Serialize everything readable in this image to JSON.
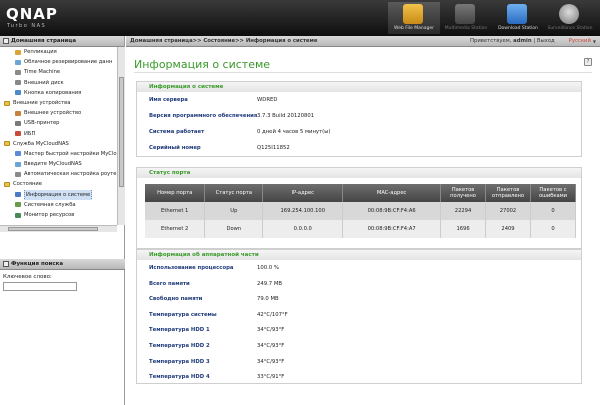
{
  "brand": {
    "logo": "QNAP",
    "subtitle": "Turbo NAS"
  },
  "apps": [
    {
      "label": "Web File Manager",
      "icon": "folder-globe-icon",
      "selected": true
    },
    {
      "label": "Multimedia Station",
      "icon": "multimedia-icon",
      "selected": false
    },
    {
      "label": "Download Station",
      "icon": "download-icon",
      "selected": false
    },
    {
      "label": "Surveillance Station",
      "icon": "camera-icon",
      "selected": false
    }
  ],
  "nav": {
    "header": "Домашняя страница",
    "items": [
      {
        "label": "Репликация",
        "level": "child",
        "icon": "replication-icon",
        "color": "#d9a43a"
      },
      {
        "label": "Облачное резервирование данн",
        "level": "child",
        "icon": "cloud-icon",
        "color": "#6aa5d8"
      },
      {
        "label": "Time Machine",
        "level": "child",
        "icon": "time-machine-icon",
        "color": "#8a8a8a"
      },
      {
        "label": "Внешний диск",
        "level": "child",
        "icon": "disk-icon",
        "color": "#888888"
      },
      {
        "label": "Кнопка копирования",
        "level": "child",
        "icon": "copy-button-icon",
        "color": "#4a8ac8"
      },
      {
        "label": "Внешние устройства",
        "level": "folder",
        "icon": "folder-icon",
        "color": "#e9c34d"
      },
      {
        "label": "Внешнее устройство",
        "level": "child",
        "icon": "external-device-icon",
        "color": "#c8823a"
      },
      {
        "label": "USB-принтер",
        "level": "child",
        "icon": "printer-icon",
        "color": "#7a7a7a"
      },
      {
        "label": "ИБП",
        "level": "child",
        "icon": "ups-icon",
        "color": "#c84a3a"
      },
      {
        "label": "Служба MyCloudNAS",
        "level": "folder",
        "icon": "folder-icon",
        "color": "#e9c34d"
      },
      {
        "label": "Мастер быстрой настройки MyClo",
        "level": "child",
        "icon": "wizard-icon",
        "color": "#5a8ad8"
      },
      {
        "label": "Введите MyCloudNAS",
        "level": "child",
        "icon": "cloud-icon",
        "color": "#6aa5d8"
      },
      {
        "label": "Автоматическая настройка роутер",
        "level": "child",
        "icon": "router-icon",
        "color": "#8a8a8a"
      },
      {
        "label": "Состояние",
        "level": "folder",
        "icon": "folder-icon",
        "color": "#e9c34d"
      },
      {
        "label": "Информация о системе",
        "level": "child",
        "icon": "info-icon",
        "color": "#4a7ac8",
        "selected": true
      },
      {
        "label": "Системная служба",
        "level": "child",
        "icon": "service-icon",
        "color": "#6a9a4a"
      },
      {
        "label": "Монитор ресурсов",
        "level": "child",
        "icon": "monitor-icon",
        "color": "#4a8a5a"
      }
    ]
  },
  "search": {
    "header": "Функция поиска",
    "label": "Ключевое слово:",
    "value": ""
  },
  "topbar": {
    "breadcrumb": "Домашняя страница>> Состояние>> Информация о системе",
    "welcome_prefix": "Приветствуем,",
    "user": "admin",
    "separator": "|",
    "logout": "Выход",
    "language": "Русский"
  },
  "page": {
    "title": "Информация о системе",
    "help": "?"
  },
  "sysinfo": {
    "header": "Информация о системе",
    "rows": [
      {
        "key": "Имя сервера",
        "value": "WDRED"
      },
      {
        "key": "Версия программного обеспечения",
        "value": "3.7.3 Build 20120801"
      },
      {
        "key": "Система работает",
        "value": "0 дней 4 часов 5 минут(ы)"
      },
      {
        "key": "Серийный номер",
        "value": "Q125I11852"
      }
    ]
  },
  "ports": {
    "header": "Статус порта",
    "columns": [
      "Номер порта",
      "Статус порта",
      "IP-адрес",
      "MAC-адрес",
      "Пакетов получено",
      "Пакетов отправлено",
      "Пакетов с ошибками"
    ],
    "rows": [
      [
        "Ethernet 1",
        "Up",
        "169.254.100.100",
        "00:08:9B:CF:F4:A6",
        "22294",
        "27002",
        "0"
      ],
      [
        "Ethernet 2",
        "Down",
        "0.0.0.0",
        "00:08:9B:CF:F4:A7",
        "1696",
        "2409",
        "0"
      ]
    ]
  },
  "hardware": {
    "header": "Информация об аппаратной части",
    "rows": [
      {
        "key": "Использование процессора",
        "value": "100.0 %"
      },
      {
        "key": "Всего памяти",
        "value": "249.7 MB"
      },
      {
        "key": "Свободно памяти",
        "value": "79.0 MB"
      },
      {
        "key": "Температура системы",
        "value": "42°C/107°F"
      },
      {
        "key": "Температура HDD 1",
        "value": "34°C/93°F"
      },
      {
        "key": "Температура HDD 2",
        "value": "34°C/93°F"
      },
      {
        "key": "Температура HDD 3",
        "value": "34°C/93°F"
      },
      {
        "key": "Температура HDD 4",
        "value": "33°C/91°F"
      }
    ]
  }
}
